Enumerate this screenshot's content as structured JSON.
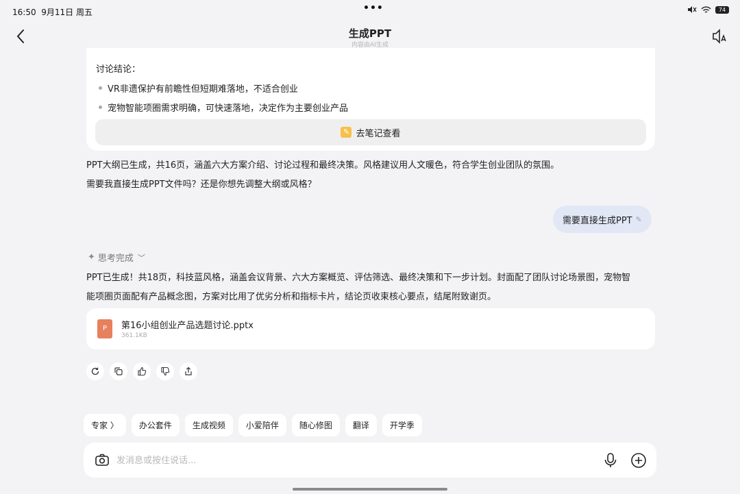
{
  "status_bar": {
    "time": "16:50",
    "date": "9月11日 周五",
    "dots": "•••",
    "battery": "74"
  },
  "header": {
    "title": "生成PPT",
    "subtitle": "内容由AI生成"
  },
  "summary_card": {
    "title": "讨论结论：",
    "bullets": [
      "VR非遗保护有前瞻性但短期难落地，不适合创业",
      "宠物智能项圈需求明确，可快速落地，决定作为主要创业产品"
    ],
    "note_button": "去笔记查看"
  },
  "assistant_reply_1": {
    "line1": "PPT大纲已生成，共16页，涵盖六大方案介绍、讨论过程和最终决策。风格建议用人文暖色，符合学生创业团队的氛围。",
    "line2": "需要我直接生成PPT文件吗？还是你想先调整大纲或风格？"
  },
  "user_message": "需要直接生成PPT",
  "thinking": "思考完成",
  "assistant_reply_2": {
    "line1": "PPT已生成！共18页，科技蓝风格，涵盖会议背景、六大方案概览、评估筛选、最终决策和下一步计划。封面配了团队讨论场景图，宠物智",
    "line2": "能项圈页面配有产品概念图，方案对比用了优劣分析和指标卡片，结论页收束核心要点，结尾附致谢页。"
  },
  "file": {
    "name": "第16小组创业产品选题讨论.pptx",
    "size": "361.1KB",
    "icon": "ppt-file-icon"
  },
  "chips": [
    "专家 〉",
    "办公套件",
    "生成视频",
    "小爱陪伴",
    "随心修图",
    "翻译",
    "开学季"
  ],
  "input": {
    "placeholder": "发消息或按住说话..."
  },
  "colors": {
    "background": "#f3f3f5",
    "user_bubble": "#e1e7f5",
    "ppt_icon": "#e7805c",
    "note_icon": "#f6c04a"
  }
}
